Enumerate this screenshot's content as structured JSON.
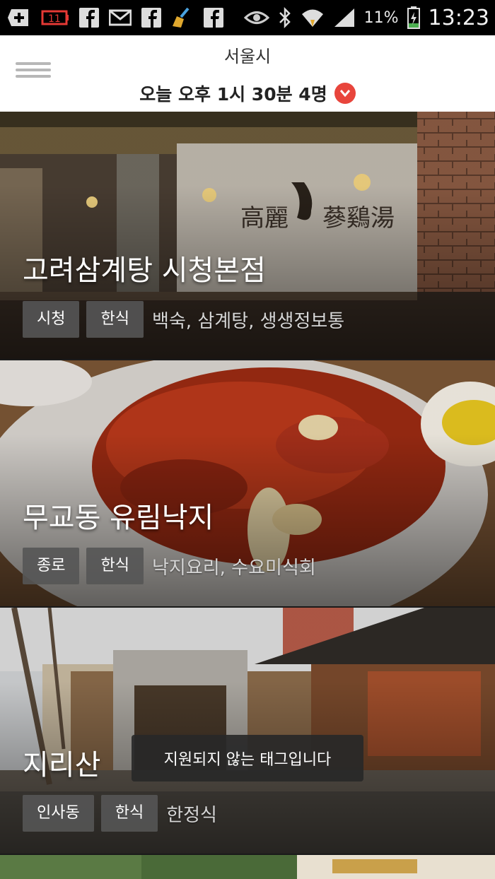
{
  "status_bar": {
    "icons": [
      "plus-icon",
      "battery-low-icon",
      "facebook-icon",
      "mail-icon",
      "facebook-icon",
      "broom-icon",
      "facebook-icon",
      "eye-icon",
      "bluetooth-icon",
      "wifi-icon",
      "signal-icon"
    ],
    "battery_percent": "11%",
    "time": "13:23"
  },
  "header": {
    "city": "서울시",
    "reservation": "오늘 오후 1시 30분 4명"
  },
  "restaurants": [
    {
      "name": "고려삼계탕 시청본점",
      "area": "시청",
      "category": "한식",
      "menu": "백숙, 삼계탕, 생생정보통"
    },
    {
      "name": "무교동 유림낙지",
      "area": "종로",
      "category": "한식",
      "menu": "낙지요리, 수요미식회"
    },
    {
      "name": "지리산",
      "area": "인사동",
      "category": "한식",
      "menu": "한정식"
    }
  ],
  "toast": "지원되지 않는 태그입니다",
  "colors": {
    "accent": "#e8453c",
    "tag_bg": "#555555"
  }
}
